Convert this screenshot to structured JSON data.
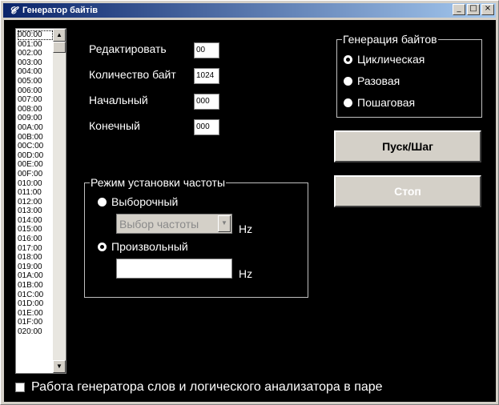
{
  "window": {
    "title": "Генератор байтів",
    "icon": "app-icon",
    "controls": {
      "minimize": "_",
      "maximize": "□",
      "close": "×"
    }
  },
  "address_list": {
    "items": [
      "000:00",
      "001:00",
      "002:00",
      "003:00",
      "004:00",
      "005:00",
      "006:00",
      "007:00",
      "008:00",
      "009:00",
      "00A:00",
      "00B:00",
      "00C:00",
      "00D:00",
      "00E:00",
      "00F:00",
      "010:00",
      "011:00",
      "012:00",
      "013:00",
      "014:00",
      "015:00",
      "016:00",
      "017:00",
      "018:00",
      "019:00",
      "01A:00",
      "01B:00",
      "01C:00",
      "01D:00",
      "01E:00",
      "01F:00",
      "020:00"
    ],
    "selected": "000:00"
  },
  "fields": {
    "edit_label": "Редактировать",
    "edit_value": "00",
    "count_label": "Количество байт",
    "count_value": "1024",
    "start_label": "Начальный",
    "start_value": "000",
    "end_label": "Конечный",
    "end_value": "000"
  },
  "generation": {
    "title": "Генерация байтов",
    "options": [
      "Циклическая",
      "Разовая",
      "Пошаговая"
    ],
    "selected": "Циклическая"
  },
  "buttons": {
    "start_step": "Пуск/Шаг",
    "stop": "Стоп"
  },
  "frequency": {
    "title": "Режим установки частоты",
    "option_select": "Выборочный",
    "combo_placeholder": "Выбор частоты",
    "unit1": "Hz",
    "option_custom": "Произвольный",
    "custom_value": "",
    "unit2": "Hz",
    "selected": "Произвольный"
  },
  "pair_mode": {
    "label": "Работа генератора слов и логического анализатора в паре",
    "checked": false
  }
}
